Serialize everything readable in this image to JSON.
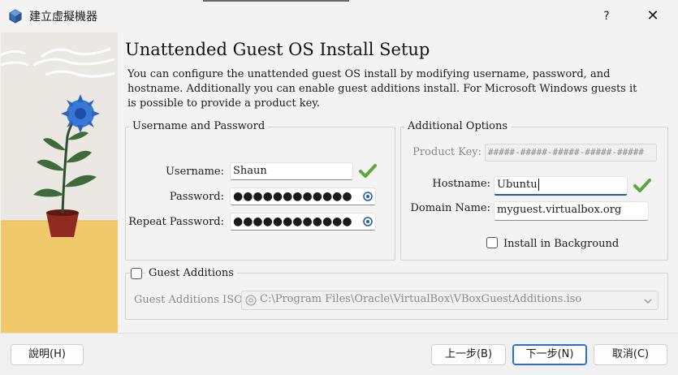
{
  "window": {
    "title": "建立虛擬機器",
    "help_label": "?",
    "close_label": "✕"
  },
  "page": {
    "heading": "Unattended Guest OS Install Setup",
    "description": "You can configure the unattended guest OS install by modifying username, password, and hostname. Additionally you can enable guest additions install. For Microsoft Windows guests it is possible to provide a product key."
  },
  "credentials": {
    "group_title": "Username and Password",
    "username_label": "Username:",
    "username_value": "Shaun",
    "password_label": "Password:",
    "password_value": "●●●●●●●●●●●●",
    "repeat_label": "Repeat Password:",
    "repeat_value": "●●●●●●●●●●●●"
  },
  "options": {
    "group_title": "Additional Options",
    "product_key_label": "Product Key:",
    "product_key_placeholder": "#####-#####-#####-#####-#####",
    "hostname_label": "Hostname:",
    "hostname_value": "Ubuntu",
    "domain_label": "Domain Name:",
    "domain_value": "myguest.virtualbox.org",
    "install_background_label": "Install in Background",
    "install_background_checked": false
  },
  "guest_additions": {
    "checkbox_label": "Guest Additions",
    "checked": false,
    "iso_label": "Guest Additions ISO:",
    "iso_path": "C:\\Program Files\\Oracle\\VirtualBox\\VBoxGuestAdditions.iso"
  },
  "buttons": {
    "help": "說明(H)",
    "back": "上一步(B)",
    "next": "下一步(N)",
    "cancel": "取消(C)"
  },
  "colors": {
    "accent": "#1f5fb0",
    "valid_check": "#5aa83a"
  }
}
